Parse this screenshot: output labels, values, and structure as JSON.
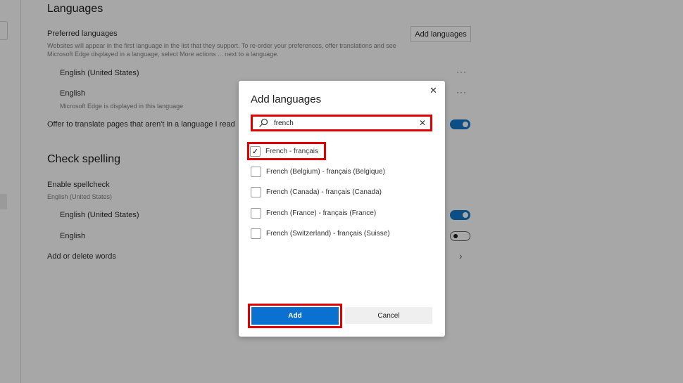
{
  "settings": {
    "languages_heading": "Languages",
    "preferred_label": "Preferred languages",
    "preferred_desc_1": "Websites will appear in the first language in the list that they support. To re-order your preferences, offer translations and see",
    "preferred_desc_2": "Microsoft Edge displayed in a language, select More actions ... next to a language.",
    "add_languages_button": "Add languages",
    "languages": [
      {
        "name": "English (United States)",
        "note": ""
      },
      {
        "name": "English",
        "note": "Microsoft Edge is displayed in this language"
      }
    ],
    "more_actions": "···",
    "translate_label": "Offer to translate pages that aren't in a language I read",
    "translate_on": true,
    "spell_heading": "Check spelling",
    "spellcheck_label": "Enable spellcheck",
    "spellcheck_sub": "English (United States)",
    "spell_languages": [
      {
        "name": "English (United States)",
        "on": true
      },
      {
        "name": "English",
        "on": false
      }
    ],
    "add_words": "Add or delete words",
    "chevron": "›"
  },
  "dialog": {
    "title": "Add languages",
    "close": "✕",
    "search_value": "french",
    "clear": "✕",
    "options": [
      {
        "label": "French - français",
        "checked": true
      },
      {
        "label": "French (Belgium) - français (Belgique)",
        "checked": false
      },
      {
        "label": "French (Canada) - français (Canada)",
        "checked": false
      },
      {
        "label": "French (France) - français (France)",
        "checked": false
      },
      {
        "label": "French (Switzerland) - français (Suisse)",
        "checked": false
      }
    ],
    "check_mark": "✓",
    "add_button": "Add",
    "cancel_button": "Cancel"
  },
  "colors": {
    "accent": "#0b71d0",
    "highlight": "#e00000",
    "overlay": "#a7a7a7"
  }
}
